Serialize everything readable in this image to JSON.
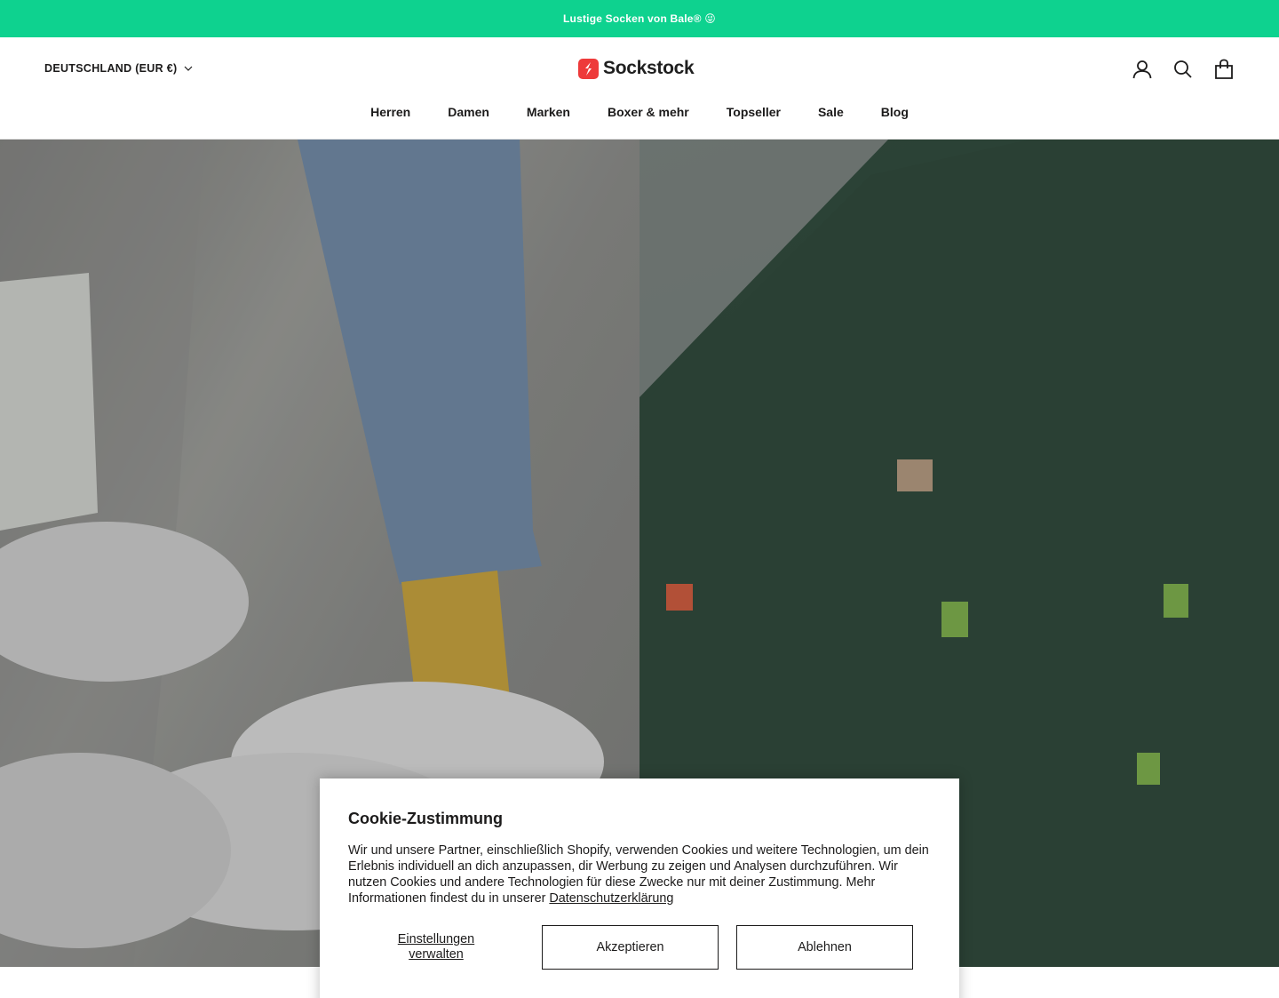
{
  "announcement": {
    "text": "Lustige Socken von Bale® 😜"
  },
  "header": {
    "country_selector": "DEUTSCHLAND (EUR €)",
    "logo_text": "Sockstock",
    "icons": [
      "account-icon",
      "search-icon",
      "cart-icon"
    ]
  },
  "nav": {
    "items": [
      {
        "label": "Herren"
      },
      {
        "label": "Damen"
      },
      {
        "label": "Marken"
      },
      {
        "label": "Boxer & mehr"
      },
      {
        "label": "Topseller"
      },
      {
        "label": "Sale"
      },
      {
        "label": "Blog"
      }
    ]
  },
  "cookie": {
    "title": "Cookie-Zustimmung",
    "body": "Wir und unsere Partner, einschließlich Shopify, verwenden Cookies und weitere Technologien, um dein Erlebnis individuell an dich anzupassen, dir Werbung zu zeigen und Analysen durchzuführen. Wir nutzen Cookies und andere Technologien für diese Zwecke nur mit deiner Zustimmung. Mehr Informationen findest du in unserer",
    "privacy_link": "Datenschutzerklärung",
    "manage_line1": "Einstellungen",
    "manage_line2": "verwalten",
    "accept_label": "Akzeptieren",
    "decline_label": "Ablehnen"
  },
  "colors": {
    "announcement_bg": "#0ed28f",
    "logo_red": "#ee3a3a",
    "text": "#1c1b1b"
  }
}
